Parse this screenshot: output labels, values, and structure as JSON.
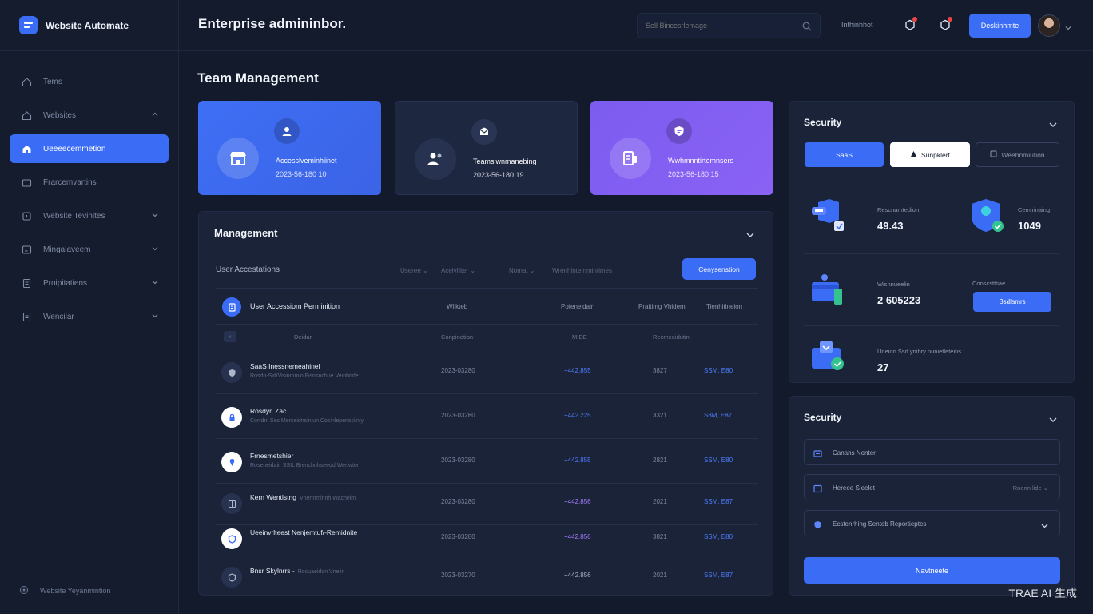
{
  "app": {
    "name": "Website Automate"
  },
  "sidebar": {
    "items": [
      {
        "label": "Tems"
      },
      {
        "label": "Websites"
      },
      {
        "label": "Ueeeecemmetion"
      },
      {
        "label": "Frarcemvartins"
      },
      {
        "label": "Website Tevinites"
      },
      {
        "label": "Mingalaveem"
      },
      {
        "label": "Proipitatiens"
      },
      {
        "label": "Wencilar"
      }
    ],
    "footer": "Website Yeyanmintion"
  },
  "header": {
    "title": "Enterprise admininbor.",
    "search_placeholder": "Sell Bincesrlemage",
    "link": "Inthinhhot",
    "button": "Deskinhmte"
  },
  "page": {
    "section_title": "Team Management"
  },
  "cards": [
    {
      "label": "Accesslveminhiinet",
      "sub": "2023-56-180 10"
    },
    {
      "label": "Teamsiwnmanebing",
      "sub": "2023-56-180 19"
    },
    {
      "label": "Wwhmnntirtemnsers",
      "sub": "2023-56-180 15"
    }
  ],
  "management": {
    "title": "Management",
    "subhead": "User Accestations",
    "filters": [
      "Useree ⌄",
      "Acelvlilter ⌄",
      "Nomat ⌄",
      "Wrenhintemmintimes"
    ],
    "button": "Cenysenstion",
    "table_header": {
      "title": "User Accessiom Perminition",
      "cols": [
        "Wilkteb",
        "Pofeneidain",
        "Praitimg Vhidem",
        "Tienhitineion"
      ]
    },
    "columns": [
      "Deidar",
      "Conpinetion",
      "MIDE",
      "Recmeeidutin"
    ],
    "rows": [
      {
        "name": "SaaS Inessnemeahinel",
        "desc": "Rosdn-Sid/Visinmmio Fisnsnchue Veinhnde",
        "date": "2023-03280",
        "amount": "+442.855",
        "num": "3827",
        "link": "SSM, E80"
      },
      {
        "name": "Rosdyr, Zac",
        "desc": "Corrdnl Ses Merseidnsiniun Cosinlepenssiiniy",
        "date": "2023-03280",
        "amount": "+442.225",
        "num": "3321",
        "link": "S8M, E87"
      },
      {
        "name": "Frnesmetshier",
        "desc": "Roseneidaiir SSIL Brenchnhseedd Werlwter",
        "date": "2023-03280",
        "amount": "+442.855",
        "num": "2821",
        "link": "SSM, E80"
      },
      {
        "name": "Kern Wentlstng",
        "desc": "Vnennminnh Wacheim",
        "date": "2023-03280",
        "amount": "+442.856",
        "num": "2021",
        "link": "SSM, E87"
      },
      {
        "name": "Ueeinvrlteest Nenjemtuf/-Remidnite",
        "desc": "",
        "date": "2023-03280",
        "amount": "+442.856",
        "num": "3821",
        "link": "SSM, E80"
      },
      {
        "name": "Bnsr Skylnrrs -",
        "desc": "Rocuaeidon Vneiin",
        "date": "2023-03270",
        "amount": "+442.856",
        "num": "2021",
        "link": "SSM, E87"
      }
    ]
  },
  "security1": {
    "title": "Security",
    "tabs": [
      "SaaS",
      "Sunpklert",
      "Weehnmiution"
    ],
    "metrics": [
      {
        "label": "Rescnamtedion",
        "value": "49.43"
      },
      {
        "label": "Cemirinaing",
        "value": "1049"
      },
      {
        "label": "Wisnnueelin",
        "value": "2 605223"
      },
      {
        "label": "Conscstttiae",
        "value": ""
      },
      {
        "label": "Uneion Ssd ynihry nunietleteins",
        "value": "27"
      }
    ],
    "button": "Bsdlamrs"
  },
  "security2": {
    "title": "Security",
    "fields": [
      {
        "label": "Canans Nonter",
        "right": ""
      },
      {
        "label": "Hereee Sleelet",
        "right": "Roenn lide ⌄"
      },
      {
        "label": "Ecstenrhing Senteb Reportieptes",
        "right": ""
      }
    ],
    "button": "Navtneete"
  },
  "watermark": "TRAE AI 生成",
  "colors": {
    "accent": "#3b6cf6",
    "purple": "#8a62f4",
    "bg": "#121a2c",
    "panel": "#1a2338"
  }
}
